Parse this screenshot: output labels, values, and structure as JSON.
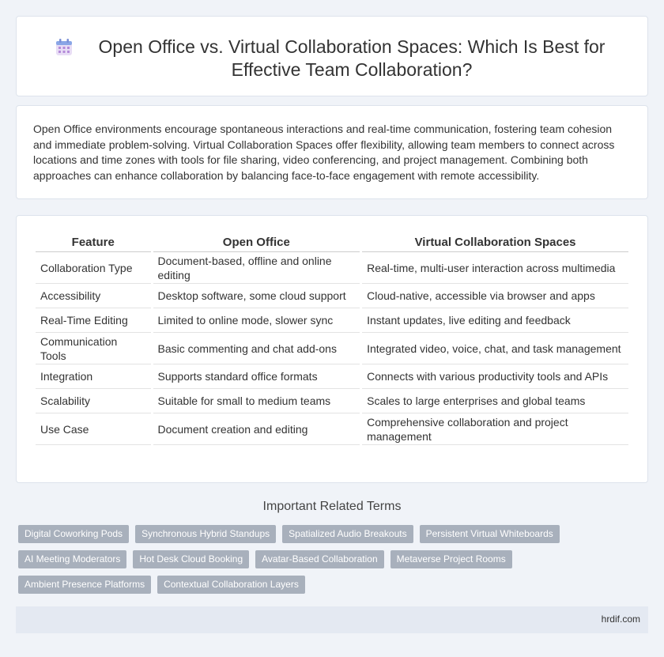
{
  "header": {
    "title": "Open Office vs. Virtual Collaboration Spaces: Which Is Best for Effective Team Collaboration?",
    "icon": "calendar-icon"
  },
  "summary": {
    "text": "Open Office environments encourage spontaneous interactions and real-time communication, fostering team cohesion and immediate problem-solving. Virtual Collaboration Spaces offer flexibility, allowing team members to connect across locations and time zones with tools for file sharing, video conferencing, and project management. Combining both approaches can enhance collaboration by balancing face-to-face engagement with remote accessibility."
  },
  "table": {
    "headers": [
      "Feature",
      "Open Office",
      "Virtual Collaboration Spaces"
    ],
    "rows": [
      [
        "Collaboration Type",
        "Document-based, offline and online editing",
        "Real-time, multi-user interaction across multimedia"
      ],
      [
        "Accessibility",
        "Desktop software, some cloud support",
        "Cloud-native, accessible via browser and apps"
      ],
      [
        "Real-Time Editing",
        "Limited to online mode, slower sync",
        "Instant updates, live editing and feedback"
      ],
      [
        "Communication Tools",
        "Basic commenting and chat add-ons",
        "Integrated video, voice, chat, and task management"
      ],
      [
        "Integration",
        "Supports standard office formats",
        "Connects with various productivity tools and APIs"
      ],
      [
        "Scalability",
        "Suitable for small to medium teams",
        "Scales to large enterprises and global teams"
      ],
      [
        "Use Case",
        "Document creation and editing",
        "Comprehensive collaboration and project management"
      ]
    ]
  },
  "related": {
    "heading": "Important Related Terms",
    "tags": [
      "Digital Coworking Pods",
      "Synchronous Hybrid Standups",
      "Spatialized Audio Breakouts",
      "Persistent Virtual Whiteboards",
      "AI Meeting Moderators",
      "Hot Desk Cloud Booking",
      "Avatar-Based Collaboration",
      "Metaverse Project Rooms",
      "Ambient Presence Platforms",
      "Contextual Collaboration Layers"
    ]
  },
  "footer": {
    "site": "hrdif.com"
  },
  "colors": {
    "background": "#f0f3f8",
    "tag_bg": "#a8b0bc",
    "footer_bg": "#e4e9f2"
  }
}
